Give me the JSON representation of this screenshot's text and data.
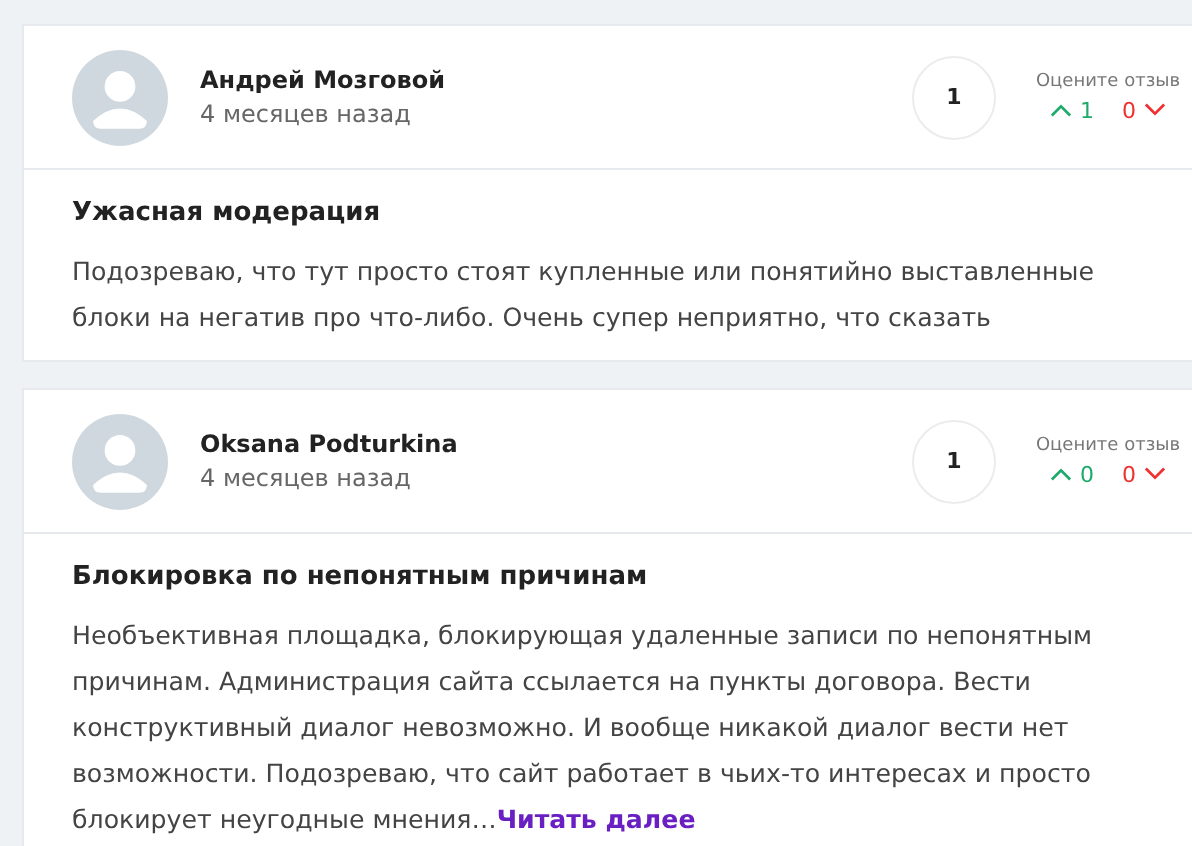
{
  "reviews": [
    {
      "author": "Андрей Мозговой",
      "time": "4 месяцев назад",
      "comments": "1",
      "rate_label": "Оцените отзыв",
      "likes": "1",
      "dislikes": "0",
      "title": "Ужасная модерация",
      "text": "Подозреваю, что тут просто стоят купленные или понятийно выставленные блоки на негатив про что-либо. Очень супер неприятно, что сказать"
    },
    {
      "author": "Oksana Podturkina",
      "time": "4 месяцев назад",
      "comments": "1",
      "rate_label": "Оцените отзыв",
      "likes": "0",
      "dislikes": "0",
      "title": "Блокировка по непонятным причинам",
      "text": "Необъективная площадка, блокирующая удаленные записи по непонятным причинам. Администрация сайта ссылается на пункты договора. Вести конструктивный диалог невозможно. И вообще никакой диалог вести нет возможности. Подозреваю, что сайт работает в чьих-то интересах и просто блокирует неугодные мнения…",
      "more": "Читать далее"
    }
  ]
}
